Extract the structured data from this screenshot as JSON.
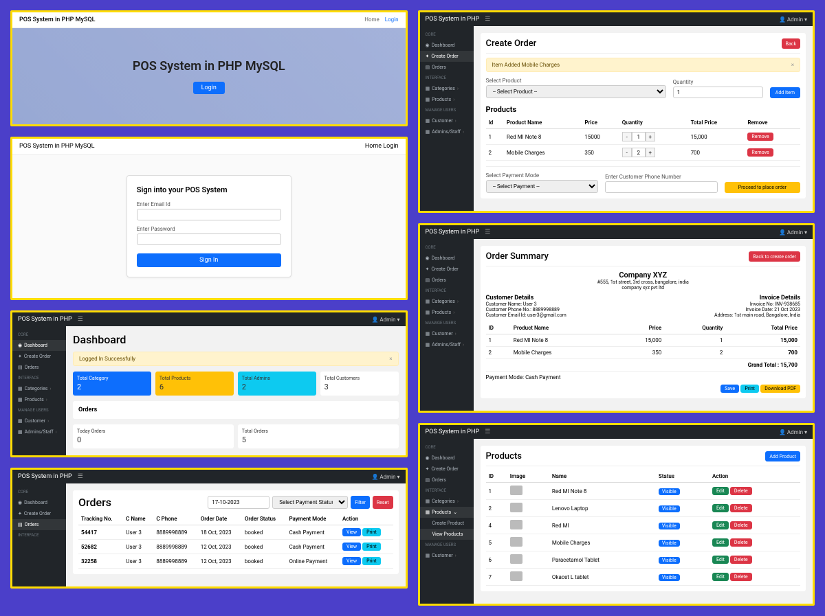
{
  "p1": {
    "brand": "POS System in PHP MySQL",
    "nav_home": "Home",
    "nav_login": "Login",
    "hero_title": "POS System in PHP MySQL",
    "login_btn": "Login"
  },
  "p2": {
    "brand": "POS System in PHP MySQL",
    "nav_home": "Home",
    "nav_login": "Login",
    "card_title": "Sign into your POS System",
    "email_label": "Enter Email Id",
    "pwd_label": "Enter Password",
    "signin_btn": "Sign In"
  },
  "sidebar": {
    "sh_core": "CORE",
    "dashboard": "Dashboard",
    "create_order": "Create Order",
    "orders": "Orders",
    "sh_interface": "INTERFACE",
    "categories": "Categories",
    "products": "Products",
    "create_product": "Create Product",
    "view_products": "View Products",
    "sh_manage": "MANAGE USERS",
    "customer": "Customer",
    "admins": "Admins/Staff"
  },
  "adminbar": {
    "brand": "POS System in PHP",
    "user": "Admin"
  },
  "p3": {
    "title": "Dashboard",
    "alert": "Logged In Successfully",
    "stats": [
      {
        "label": "Total Category",
        "value": "2"
      },
      {
        "label": "Total Products",
        "value": "6"
      },
      {
        "label": "Total Admins",
        "value": "2"
      },
      {
        "label": "Total Customers",
        "value": "3"
      }
    ],
    "orders_title": "Orders",
    "today_label": "Today Orders",
    "today_val": "0",
    "total_label": "Total Orders",
    "total_val": "5"
  },
  "p4": {
    "title": "Orders",
    "date": "17-10-2023",
    "status_sel": "Select Payment Status",
    "filter": "Filter",
    "reset": "Reset",
    "cols": [
      "Tracking No.",
      "C Name",
      "C Phone",
      "Order Date",
      "Order Status",
      "Payment Mode",
      "Action"
    ],
    "rows": [
      [
        "54417",
        "User 3",
        "8889998889",
        "18 Oct, 2023",
        "booked",
        "Cash Payment"
      ],
      [
        "52682",
        "User 3",
        "8889998889",
        "12 Oct, 2023",
        "booked",
        "Cash Payment"
      ],
      [
        "32258",
        "User 3",
        "8889998889",
        "12 Oct, 2023",
        "booked",
        "Online Payment"
      ]
    ],
    "view": "View",
    "print": "Print"
  },
  "p5": {
    "title": "Create Order",
    "back": "Back",
    "alert": "Item Added Mobile Charges",
    "sel_prod": "Select Product",
    "sel_prod_ph": "-- Select Product --",
    "qty": "Quantity",
    "qty_val": "1",
    "add_item": "Add Item",
    "products": "Products",
    "cols": [
      "Id",
      "Product Name",
      "Price",
      "Quantity",
      "Total Price",
      "Remove"
    ],
    "rows": [
      {
        "id": "1",
        "name": "Red MI Note 8",
        "price": "15000",
        "qty": "1",
        "total": "15,000"
      },
      {
        "id": "2",
        "name": "Mobile Charges",
        "price": "350",
        "qty": "2",
        "total": "700"
      }
    ],
    "remove": "Remove",
    "pay_mode": "Select Payment Mode",
    "pay_ph": "-- Select Payment --",
    "phone": "Enter Customer Phone Number",
    "proceed": "Proceed to place order"
  },
  "p6": {
    "title": "Order Summary",
    "back": "Back to create order",
    "company": "Company XYZ",
    "addr": "#555, 1st street, 3rd cross, bangalore, india",
    "sub": "company xyz pvt ltd",
    "cust_h": "Customer Details",
    "cust_name": "Customer Name: User 3",
    "cust_phone": "Customer Phone No.: 8889998889",
    "cust_email": "Customer Email Id: user3@gmail.com",
    "inv_h": "Invoice Details",
    "inv_no": "Invoice No: INV-938685",
    "inv_date": "Invoice Date: 21 Oct 2023",
    "inv_addr": "Address: 1st main road, Bangalore, India",
    "cols": [
      "ID",
      "Product Name",
      "Price",
      "Quantity",
      "Total Price"
    ],
    "rows": [
      [
        "1",
        "Red MI Note 8",
        "15,000",
        "1",
        "15,000"
      ],
      [
        "2",
        "Mobile Charges",
        "350",
        "2",
        "700"
      ]
    ],
    "grand": "Grand Total : 15,700",
    "pay": "Payment Mode: Cash Payment",
    "save": "Save",
    "print": "Print",
    "dl": "Download PDF"
  },
  "p7": {
    "title": "Products",
    "add": "Add Product",
    "cols": [
      "ID",
      "Image",
      "Name",
      "Status",
      "Action"
    ],
    "rows": [
      {
        "id": "1",
        "name": "Red MI Note 8",
        "status": "Visible"
      },
      {
        "id": "2",
        "name": "Lenovo Laptop",
        "status": "Visible"
      },
      {
        "id": "4",
        "name": "Red MI",
        "status": "Visible"
      },
      {
        "id": "5",
        "name": "Mobile Charges",
        "status": "Visible"
      },
      {
        "id": "6",
        "name": "Paracetamol Tablet",
        "status": "Visible"
      },
      {
        "id": "7",
        "name": "Okacet L tablet",
        "status": "Visible"
      }
    ],
    "edit": "Edit",
    "del": "Delete"
  }
}
